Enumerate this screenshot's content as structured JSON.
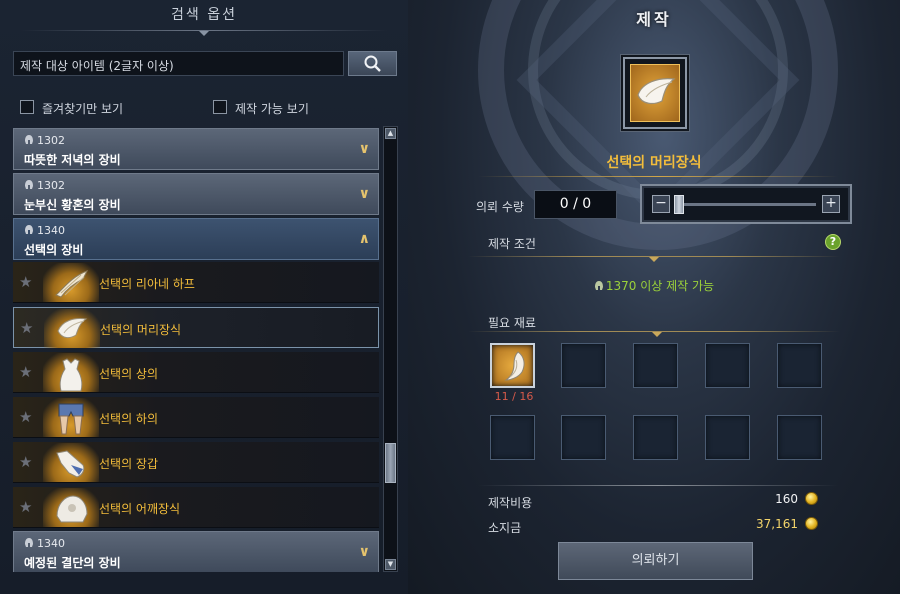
{
  "left_panel": {
    "header": "검색 옵션",
    "search": {
      "placeholder": "제작 대상 아이템 (2글자 이상)"
    },
    "filters": [
      {
        "label": "즐겨찾기만 보기",
        "checked": false
      },
      {
        "label": "제작 가능 보기",
        "checked": false
      }
    ],
    "groups": [
      {
        "level": "1302",
        "name": "따뜻한 저녁의 장비",
        "expanded": false
      },
      {
        "level": "1302",
        "name": "눈부신 황혼의 장비",
        "expanded": false
      },
      {
        "level": "1340",
        "name": "선택의 장비",
        "expanded": true
      },
      {
        "level": "1340",
        "name": "예정된 결단의 장비",
        "expanded": false
      }
    ],
    "items": [
      {
        "name": "선택의 리아네 하프",
        "icon": "harp-icon",
        "selected": false
      },
      {
        "name": "선택의 머리장식",
        "icon": "headpiece-icon",
        "selected": true
      },
      {
        "name": "선택의 상의",
        "icon": "top-icon",
        "selected": false
      },
      {
        "name": "선택의 하의",
        "icon": "bottom-icon",
        "selected": false
      },
      {
        "name": "선택의 장갑",
        "icon": "glove-icon",
        "selected": false
      },
      {
        "name": "선택의 어깨장식",
        "icon": "shoulder-icon",
        "selected": false
      }
    ]
  },
  "craft": {
    "title": "제작",
    "selected_item": "선택의 머리장식",
    "request_qty_label": "의뢰 수량",
    "request_qty": "0 / 0",
    "conditions_label": "제작 조건",
    "condition_text": "1370 이상 제작 가능",
    "materials_label": "필요 재료",
    "materials": [
      {
        "icon": "claw-material-icon",
        "count": "11 / 16"
      }
    ],
    "cost_label": "제작비용",
    "cost": "160",
    "money_label": "소지금",
    "money": "37,161",
    "request_button": "의뢰하기"
  },
  "colors": {
    "accent_gold": "#f3bd3b",
    "condition_green": "#9bd23a",
    "shortfall_red": "#d65a4a"
  }
}
